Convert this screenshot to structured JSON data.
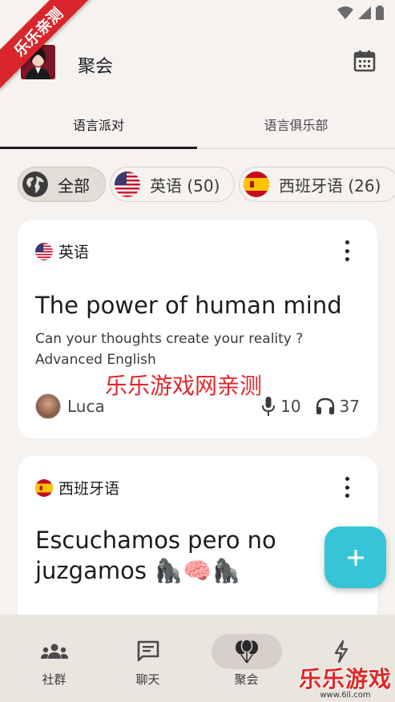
{
  "watermarks": {
    "ribbon": "乐乐亲测",
    "center": "乐乐游戏网亲测",
    "corner_big": "乐乐游戏",
    "corner_small": "www.6ll.com"
  },
  "app_bar": {
    "title": "聚会"
  },
  "tabs": [
    {
      "label": "语言派对",
      "selected": true
    },
    {
      "label": "语言俱乐部",
      "selected": false
    }
  ],
  "chips": [
    {
      "label": "全部",
      "selected": true,
      "icon": "globe-icon"
    },
    {
      "label": "英语 (50)",
      "selected": false,
      "icon": "us-flag-icon"
    },
    {
      "label": "西班牙语 (26)",
      "selected": false,
      "icon": "spain-flag-icon"
    }
  ],
  "cards": [
    {
      "language": "英语",
      "title": "The power of human mind",
      "desc_line1": "Can your thoughts  create your reality ?",
      "desc_line2": "Advanced English",
      "host": "Luca",
      "speakers": "10",
      "listeners": "37"
    },
    {
      "language": "西班牙语",
      "title": "Escuchamos pero no juzgamos 🦍🧠🦍"
    }
  ],
  "nav": [
    {
      "label": "社群",
      "icon": "community-icon",
      "active": false
    },
    {
      "label": "聊天",
      "icon": "chat-icon",
      "active": false
    },
    {
      "label": "聚会",
      "icon": "balloons-icon",
      "active": true
    },
    {
      "label": "",
      "icon": "lightning-icon",
      "active": false
    }
  ],
  "colors": {
    "accent": "#36c5d6",
    "background": "#f5f2ef",
    "ribbon": "#d8262c"
  }
}
